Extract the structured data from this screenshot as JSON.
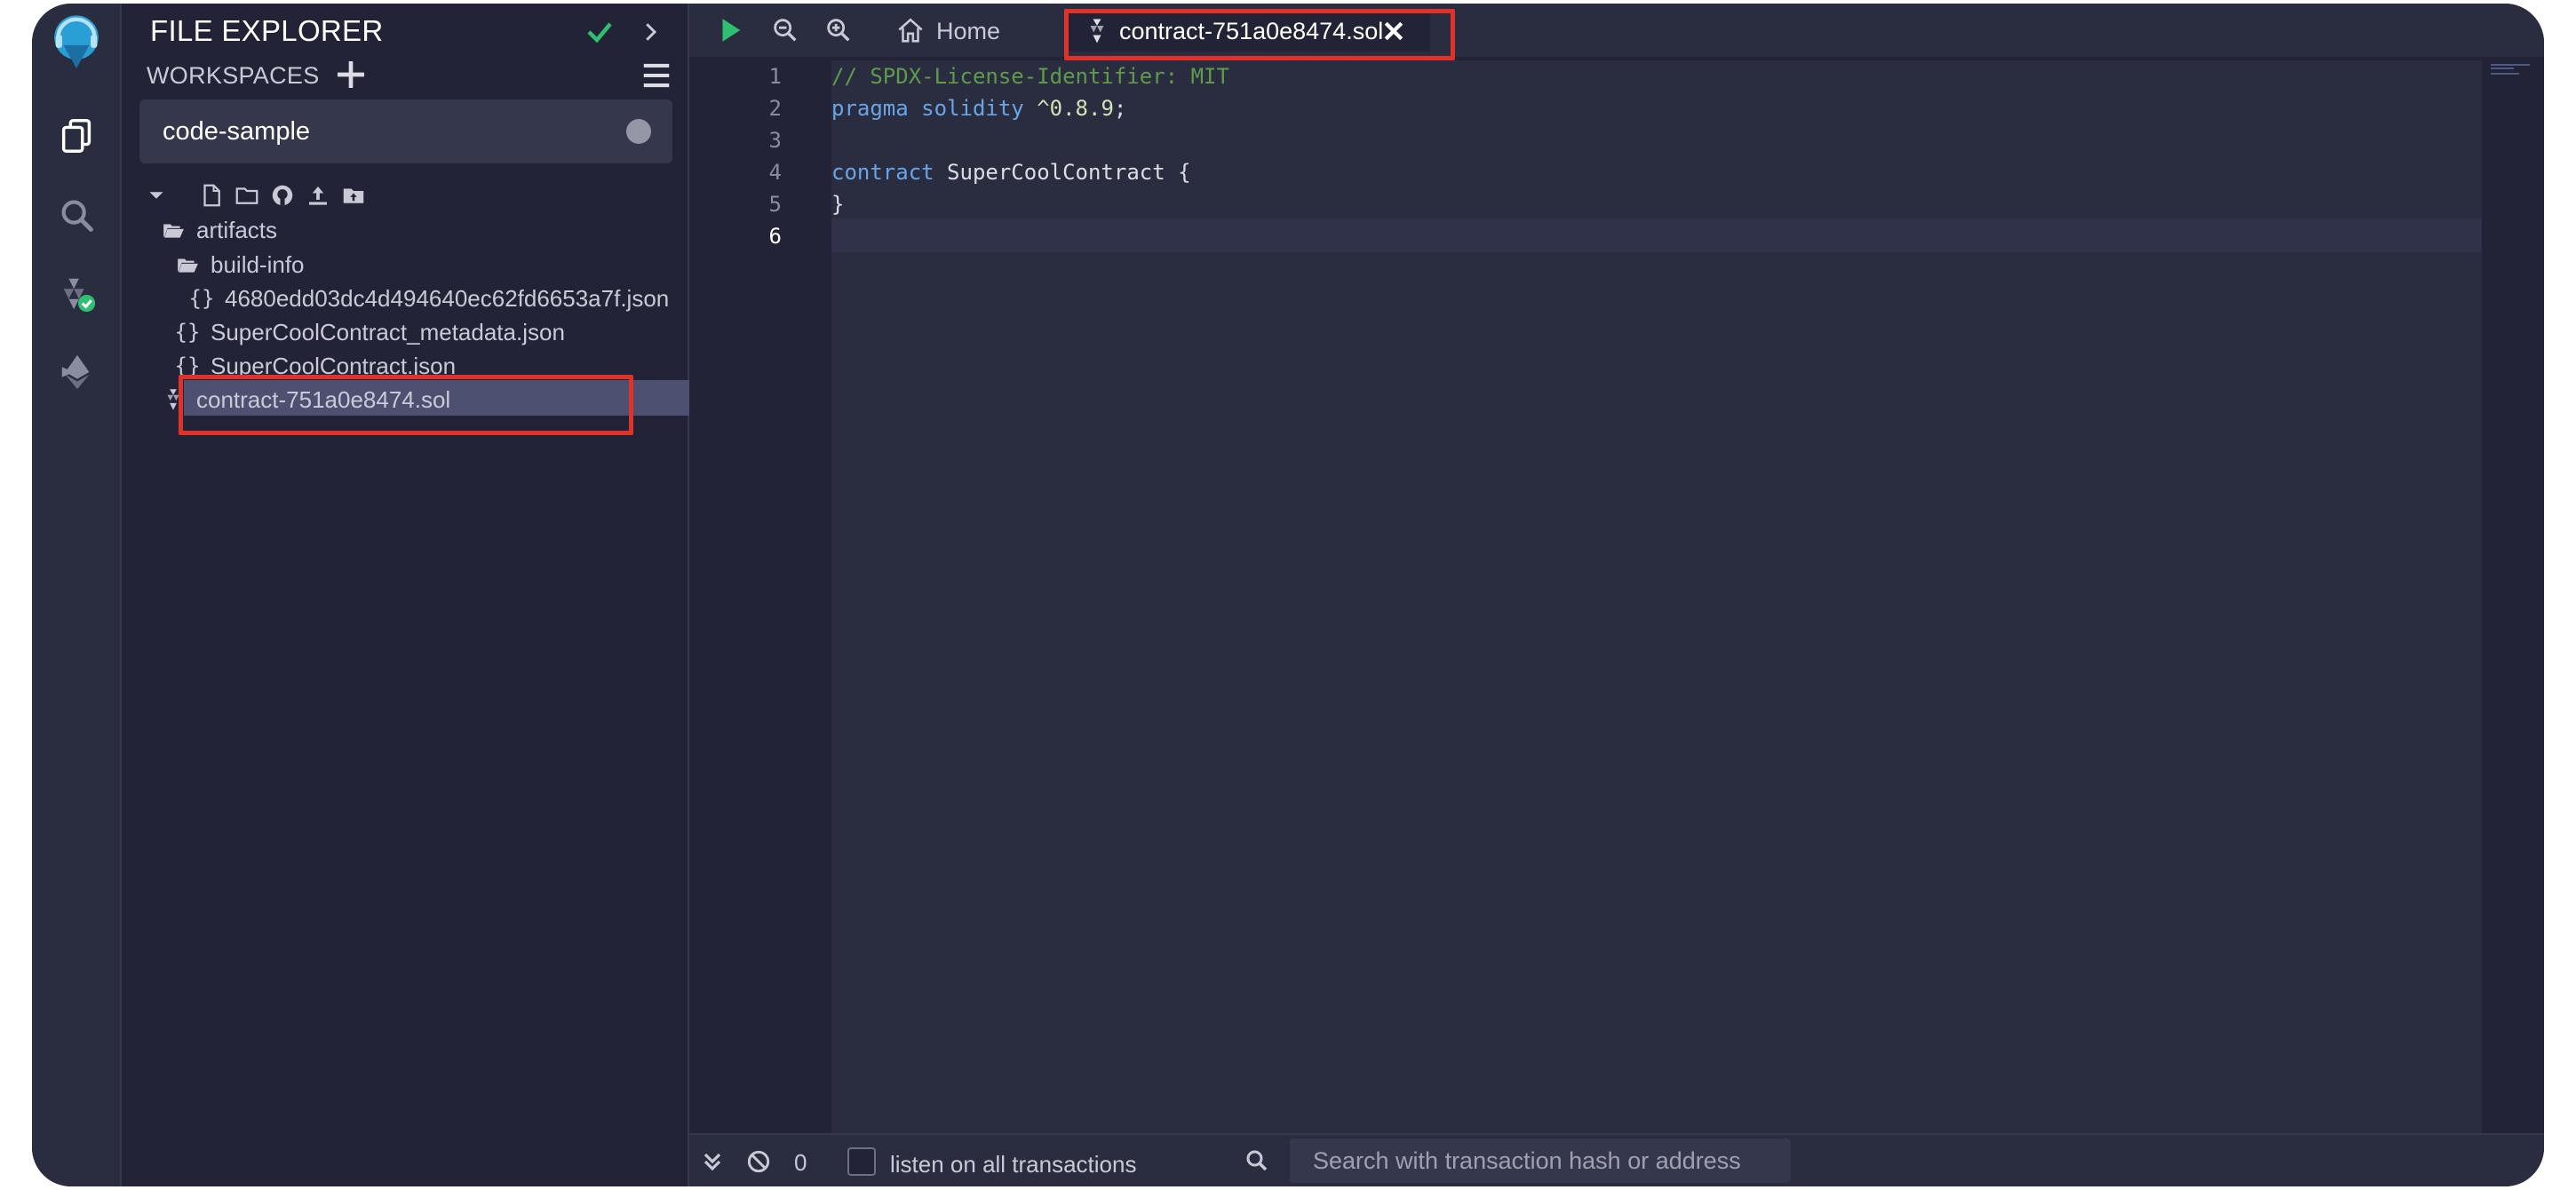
{
  "sidebar": {
    "title": "FILE EXPLORER",
    "workspaces_label": "WORKSPACES",
    "workspace_selected": "code-sample",
    "tree": {
      "artifacts": "artifacts",
      "build_info": "build-info",
      "json_hash": "4680edd03dc4d494640ec62fd6653a7f.json",
      "metadata": "SuperCoolContract_metadata.json",
      "contract_json": "SuperCoolContract.json",
      "sol_file": "contract-751a0e8474.sol"
    }
  },
  "editor": {
    "tabs": {
      "home": "Home",
      "active": "contract-751a0e8474.sol"
    },
    "line_numbers": [
      "1",
      "2",
      "3",
      "4",
      "5",
      "6"
    ],
    "code": {
      "l1_comment": "// SPDX-License-Identifier: MIT",
      "l2_kw1": "pragma",
      "l2_kw2": "solidity",
      "l2_ver": "^0.8.9",
      "l2_end": ";",
      "l4_kw": "contract",
      "l4_name": " SuperCoolContract {",
      "l5": "}"
    }
  },
  "terminal": {
    "count": "0",
    "listen_label": "listen on all transactions",
    "search_placeholder": "Search with transaction hash or address"
  },
  "colors": {
    "highlight_box": "#e03228",
    "accent_green": "#2fbf71",
    "logo_blue": "#2a9fd6"
  }
}
